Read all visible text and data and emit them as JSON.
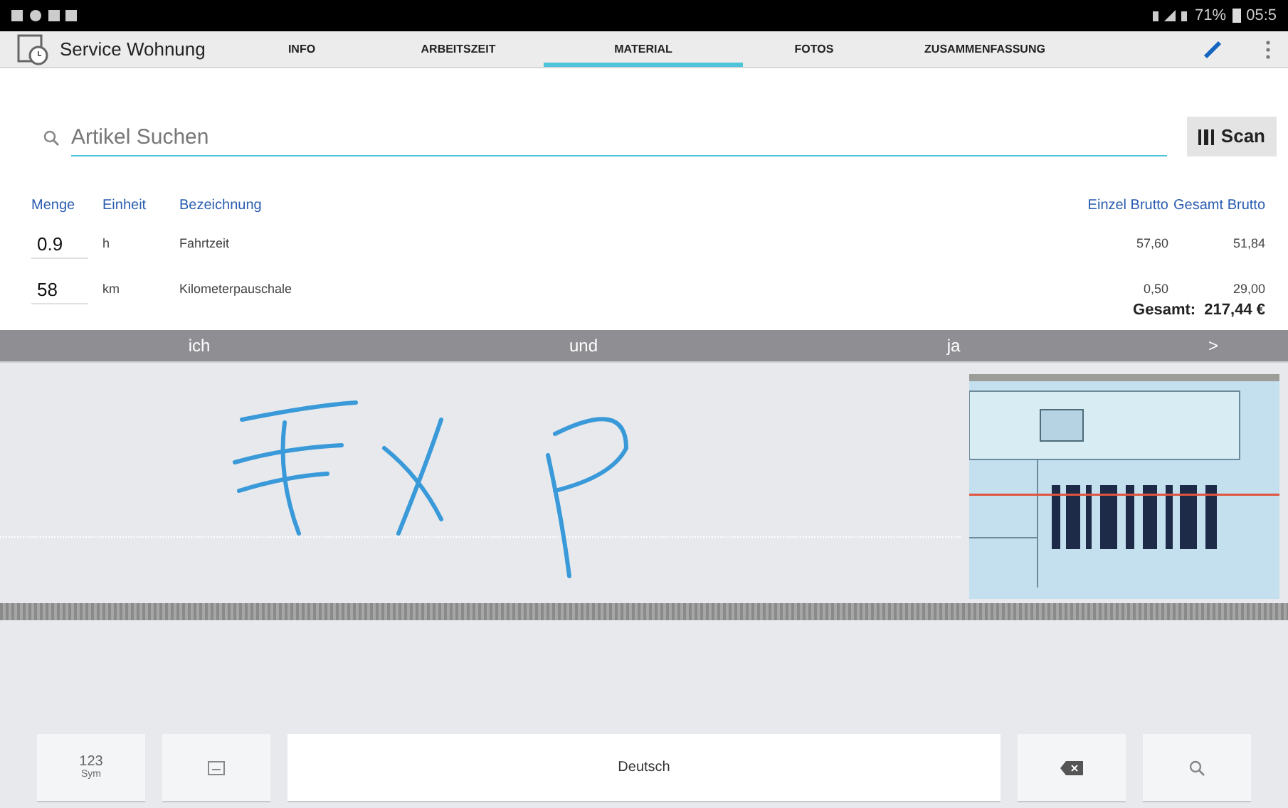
{
  "status_bar": {
    "battery": "71%",
    "time": "05:5"
  },
  "app_bar": {
    "title": "Service Wohnung",
    "tabs": [
      {
        "label": "INFO",
        "selected": false
      },
      {
        "label": "ARBEITSZEIT",
        "selected": false
      },
      {
        "label": "MATERIAL",
        "selected": true
      },
      {
        "label": "FOTOS",
        "selected": false
      },
      {
        "label": "ZUSAMMENFASSUNG",
        "selected": false
      }
    ]
  },
  "search": {
    "placeholder": "Artikel Suchen",
    "scan_button": "Scan"
  },
  "table": {
    "columns": [
      "Menge",
      "Einheit",
      "Bezeichnung",
      "Einzel Brutto",
      "Gesamt Brutto"
    ],
    "rows": [
      {
        "menge": "0.9",
        "einheit": "h",
        "bezeichnung": "Fahrtzeit",
        "einzel": "57,60",
        "gesamt": "51,84"
      },
      {
        "menge": "58",
        "einheit": "km",
        "bezeichnung": "Kilometerpauschale",
        "einzel": "0,50",
        "gesamt": "29,00"
      }
    ],
    "total": "Gesamt:  217,44 €"
  },
  "keyboard": {
    "suggestions": [
      "ich",
      "und",
      "ja",
      ">"
    ],
    "keys": [
      {
        "kind": "symbols",
        "label": "123",
        "sublabel": "Sym"
      },
      {
        "kind": "mode"
      },
      {
        "kind": "space",
        "label": "Deutsch"
      },
      {
        "kind": "backspace"
      },
      {
        "kind": "search"
      }
    ]
  }
}
